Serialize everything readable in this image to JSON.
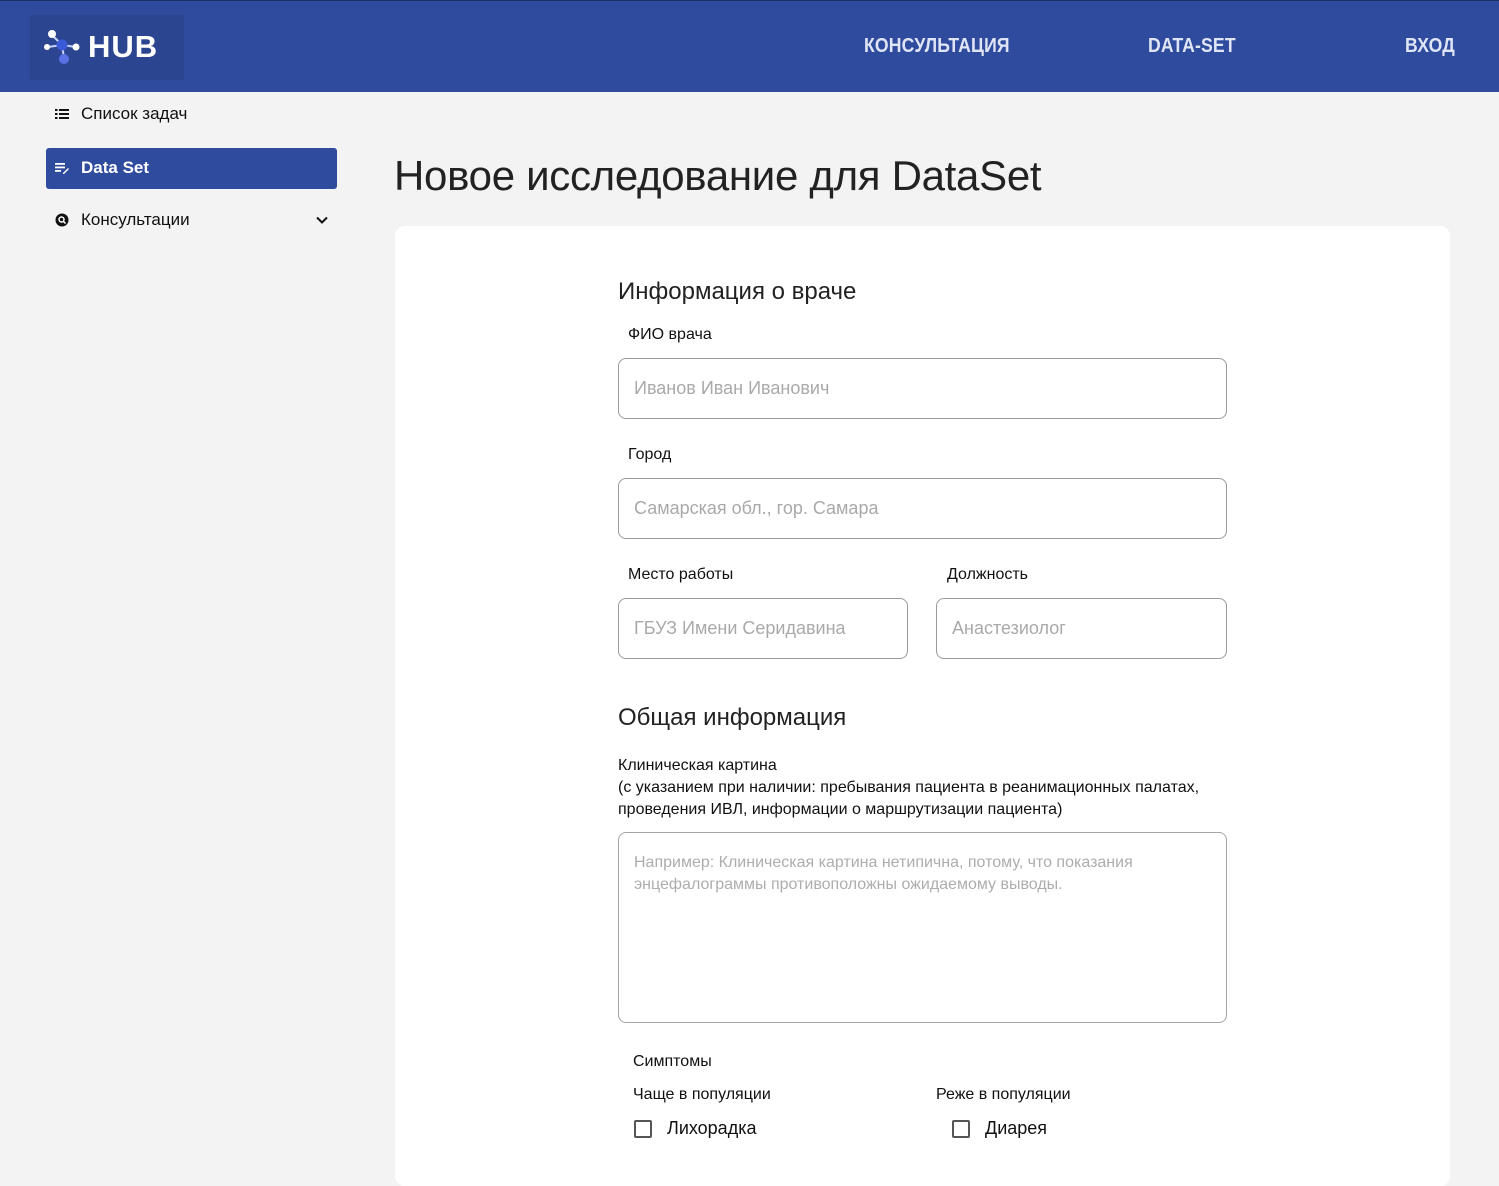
{
  "header": {
    "logo_text": "HUB",
    "nav": {
      "consultation": "КОНСУЛЬТАЦИЯ",
      "dataset": "DATA-SET",
      "login": "ВХОД"
    }
  },
  "sidebar": {
    "items": [
      {
        "label": "Список задач",
        "icon": "list-icon"
      },
      {
        "label": "Data Set",
        "icon": "edit-note-icon",
        "active": true
      },
      {
        "label": "Консультации",
        "icon": "search-bubble-icon"
      }
    ]
  },
  "page": {
    "title": "Новое исследование для DataSet"
  },
  "doctor": {
    "section_title": "Информация о враче",
    "fio_label": "ФИО врача",
    "fio_placeholder": "Иванов Иван Иванович",
    "city_label": "Город",
    "city_placeholder": "Самарская обл., гор. Самара",
    "workplace_label": "Место работы",
    "workplace_placeholder": "ГБУЗ Имени Серидавина",
    "position_label": "Должность",
    "position_placeholder": "Анастезиолог"
  },
  "general": {
    "section_title": "Общая информация",
    "clinical_title": "Клиническая картина",
    "clinical_note": "(с указанием при наличии: пребывания пациента в реанимационных палатах, проведения ИВЛ, информации о маршрутизации пациента)",
    "clinical_placeholder": "Например: Клиническая картина нетипична, потому, что показания энцефалограммы противоположны ожидаемому выводы."
  },
  "symptoms": {
    "title": "Симптомы",
    "frequent_title": "Чаще в популяции",
    "rare_title": "Реже в популяции",
    "frequent": [
      {
        "label": "Лихорадка",
        "checked": false
      }
    ],
    "rare": [
      {
        "label": "Диарея",
        "checked": false
      }
    ]
  },
  "colors": {
    "primary": "#2f4b9e",
    "background": "#f2f3f2",
    "card": "#ffffff"
  }
}
